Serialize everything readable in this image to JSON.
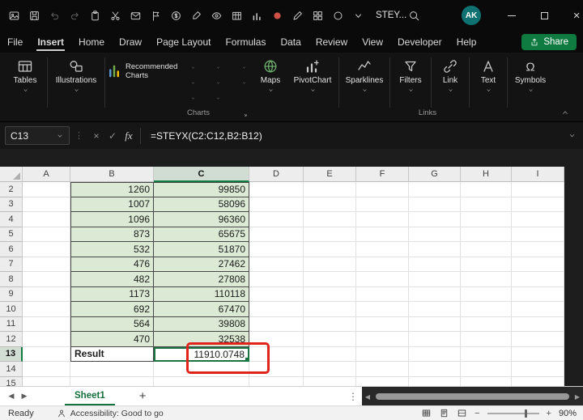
{
  "colors": {
    "accent_green": "#107C41",
    "selection_green": "#1A7340",
    "cell_fill_green": "#DCEAD5",
    "annotation_red": "#E0241B",
    "avatar_teal": "#0F7172",
    "share_green": "#0F7B41"
  },
  "title_bar": {
    "workbook_title": "STEY...",
    "avatar_initials": "AK",
    "close_glyph": "×",
    "qat_icons": [
      {
        "name": "picture-icon"
      },
      {
        "name": "save-icon"
      },
      {
        "name": "undo-icon"
      },
      {
        "name": "redo-icon"
      },
      {
        "name": "clipboard-icon"
      },
      {
        "name": "scissors-icon"
      },
      {
        "name": "mail-icon"
      },
      {
        "name": "flag-icon"
      },
      {
        "name": "currency-icon"
      },
      {
        "name": "brush-icon"
      },
      {
        "name": "eye-icon"
      },
      {
        "name": "table-icon"
      },
      {
        "name": "chart-icon"
      },
      {
        "name": "record-icon"
      },
      {
        "name": "pen-icon"
      },
      {
        "name": "grid-icon"
      },
      {
        "name": "shape-icon"
      },
      {
        "name": "chevron-down-icon"
      }
    ]
  },
  "ribbon": {
    "tabs": [
      {
        "label": "File"
      },
      {
        "label": "Insert",
        "active": true
      },
      {
        "label": "Home"
      },
      {
        "label": "Draw"
      },
      {
        "label": "Page Layout"
      },
      {
        "label": "Formulas"
      },
      {
        "label": "Data"
      },
      {
        "label": "Review"
      },
      {
        "label": "View"
      },
      {
        "label": "Developer"
      },
      {
        "label": "Help"
      }
    ],
    "share_label": "Share",
    "buttons": [
      {
        "name": "tables-button",
        "label": "Tables",
        "icon": "tables-icon"
      },
      {
        "name": "illustrations-button",
        "label": "Illustrations",
        "icon": "illustrations-icon"
      },
      {
        "name": "recommended-charts-button",
        "label": "Recommended Charts",
        "icon": "recommended-charts-icon"
      },
      {
        "name": "maps-button",
        "label": "Maps",
        "icon": "globe-icon"
      },
      {
        "name": "pivotchart-button",
        "label": "PivotChart",
        "icon": "pivotchart-icon"
      },
      {
        "name": "sparklines-button",
        "label": "Sparklines",
        "icon": "sparklines-icon"
      },
      {
        "name": "filters-button",
        "label": "Filters",
        "icon": "filter-icon"
      },
      {
        "name": "link-button",
        "label": "Link",
        "icon": "link-icon"
      },
      {
        "name": "text-button",
        "label": "Text",
        "icon": "text-icon"
      },
      {
        "name": "symbols-button",
        "label": "Symbols",
        "icon": "omega-icon"
      }
    ],
    "chart_gallery_icons": [
      {
        "name": "column-chart-icon"
      },
      {
        "name": "bar-chart-icon"
      },
      {
        "name": "combo-chart-icon"
      },
      {
        "name": "scatter-chart-icon"
      },
      {
        "name": "line-chart-icon"
      },
      {
        "name": "area-chart-icon"
      },
      {
        "name": "pie-chart-icon"
      },
      {
        "name": "map-chart-icon"
      }
    ],
    "group_labels": [
      "Charts",
      "Links"
    ]
  },
  "formula_bar": {
    "name_box": "C13",
    "divider_glyph": "⋮",
    "cancel_glyph": "×",
    "enter_glyph": "✓",
    "fx": "fx",
    "formula": "=STEYX(C2:C12,B2:B12)"
  },
  "grid": {
    "columns": [
      "A",
      "B",
      "C",
      "D",
      "E",
      "F",
      "G",
      "H",
      "I"
    ],
    "selected_column": "C",
    "selected_row": "13",
    "selected_cell": "C13",
    "rows": [
      {
        "n": "2",
        "b": "1260",
        "c": "99850"
      },
      {
        "n": "3",
        "b": "1007",
        "c": "58096"
      },
      {
        "n": "4",
        "b": "1096",
        "c": "96360"
      },
      {
        "n": "5",
        "b": "873",
        "c": "65675"
      },
      {
        "n": "6",
        "b": "532",
        "c": "51870"
      },
      {
        "n": "7",
        "b": "476",
        "c": "27462"
      },
      {
        "n": "8",
        "b": "482",
        "c": "27808"
      },
      {
        "n": "9",
        "b": "1173",
        "c": "110118"
      },
      {
        "n": "10",
        "b": "692",
        "c": "67470"
      },
      {
        "n": "11",
        "b": "564",
        "c": "39808"
      },
      {
        "n": "12",
        "b": "470",
        "c": "32538"
      },
      {
        "n": "13",
        "b": "Result",
        "c": "11910.0748"
      },
      {
        "n": "14",
        "b": "",
        "c": ""
      },
      {
        "n": "15",
        "b": "",
        "c": ""
      }
    ]
  },
  "sheet_bar": {
    "prev_glyph": "◀",
    "next_glyph": "▶",
    "tabs": [
      {
        "label": "Sheet1",
        "active": true
      }
    ],
    "add_glyph": "+",
    "dots_glyph": "⋮",
    "scroll_left_glyph": "◀",
    "scroll_right_glyph": "▶"
  },
  "status_bar": {
    "mode": "Ready",
    "accessibility": "Accessibility: Good to go",
    "zoom_out_glyph": "−",
    "zoom_in_glyph": "+",
    "zoom": "90%"
  }
}
